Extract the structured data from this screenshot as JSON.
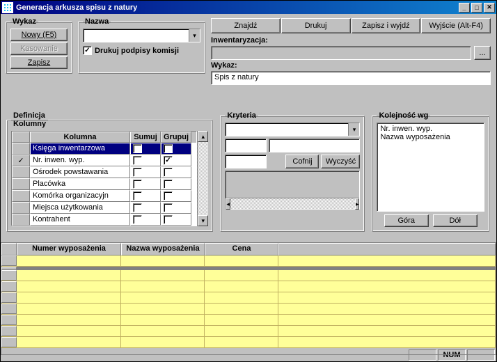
{
  "window": {
    "title": "Generacja arkusza spisu z natury"
  },
  "wykaz": {
    "legend": "Wykaz",
    "buttons": {
      "nowy": "Nowy (F5)",
      "kasowanie": "Kasowanie",
      "zapisz": "Zapisz"
    }
  },
  "nazwa": {
    "legend": "Nazwa",
    "value": "",
    "drukuj_podpisy": {
      "label": "Drukuj podpisy komisji",
      "checked": true
    }
  },
  "toolbar": {
    "znajdz": "Znajdź",
    "drukuj": "Drukuj",
    "zapisz_wyjdz": "Zapisz i wyjdź",
    "wyjscie": "Wyjście (Alt-F4)"
  },
  "inwentaryzacja": {
    "label": "Inwentaryzacja:",
    "value": "",
    "browse": "..."
  },
  "wykaz_field": {
    "label": "Wykaz:",
    "value": "Spis z natury"
  },
  "definicja": {
    "legend": "Definicja\nKolumny",
    "headers": {
      "kolumna": "Kolumna",
      "sumuj": "Sumuj",
      "grupuj": "Grupuj"
    },
    "rows": [
      {
        "name": "Księga inwentarzowa",
        "sumuj": false,
        "grupuj": false,
        "selected": true,
        "checked": false
      },
      {
        "name": "Nr. inwen. wyp.",
        "sumuj": false,
        "grupuj": true,
        "checked": true
      },
      {
        "name": "Ośrodek powstawania",
        "sumuj": false,
        "grupuj": false,
        "checked": false
      },
      {
        "name": "Placówka",
        "sumuj": false,
        "grupuj": false,
        "checked": false
      },
      {
        "name": "Komórka organizacyjn",
        "sumuj": false,
        "grupuj": false,
        "checked": false
      },
      {
        "name": "Miejsca użytkowania",
        "sumuj": false,
        "grupuj": false,
        "checked": false
      },
      {
        "name": "Kontrahent",
        "sumuj": false,
        "grupuj": false,
        "checked": false
      }
    ]
  },
  "kryteria": {
    "legend": "Kryteria",
    "cofnij": "Cofnij",
    "wyczysc": "Wyczyść"
  },
  "kolejnosc": {
    "legend": "Kolejność wg",
    "items": [
      "Nr. inwen. wyp.",
      "Nazwa wyposażenia"
    ],
    "gora": "Góra",
    "dol": "Dół"
  },
  "datagrid": {
    "columns": [
      "Numer wyposażenia",
      "Nazwa wyposażenia",
      "Cena"
    ]
  },
  "statusbar": {
    "num": "NUM"
  }
}
